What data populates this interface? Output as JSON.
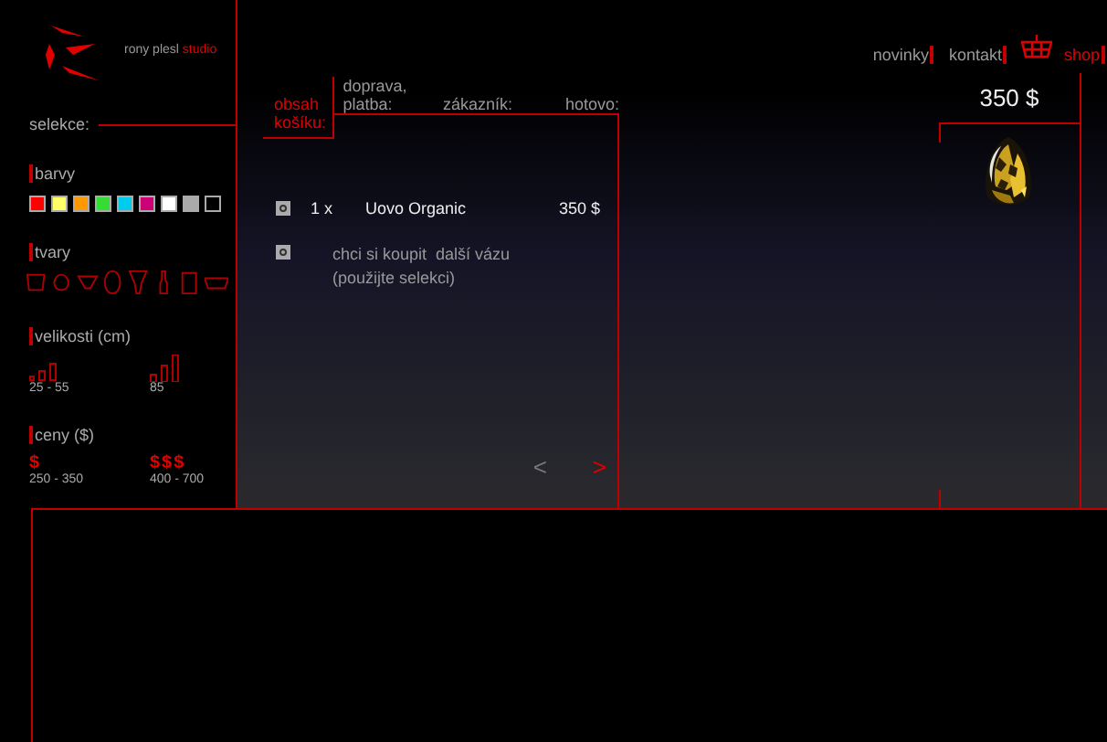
{
  "brand": {
    "name": "rony plesl",
    "suffix": "studio"
  },
  "nav": [
    {
      "label": "novinky",
      "selected": false,
      "kind": "text"
    },
    {
      "label": "kontakt",
      "selected": false,
      "kind": "text"
    },
    {
      "label": "shop",
      "selected": true,
      "kind": "basket"
    }
  ],
  "sidebar": {
    "title": "selekce:",
    "colors": {
      "heading": "barvy",
      "swatches": [
        {
          "color": "#ff0000"
        },
        {
          "color": "#ffff66"
        },
        {
          "color": "#ff9900"
        },
        {
          "color": "#33dd33"
        },
        {
          "color": "#00ccee"
        },
        {
          "color": "#cc0077"
        },
        {
          "color": "#ffffff"
        },
        {
          "color": "#aaaaaa"
        },
        {
          "color": "#000000"
        }
      ]
    },
    "shapes": {
      "heading": "tvary"
    },
    "sizes": {
      "heading": "velikosti (cm)",
      "groups": [
        {
          "label": "25 - 55"
        },
        {
          "label": "85"
        }
      ]
    },
    "prices": {
      "heading": "ceny ($)",
      "groups": [
        {
          "symbol": "$",
          "label": "250 - 350"
        },
        {
          "symbol": "$$$",
          "label": "400 - 700"
        }
      ]
    }
  },
  "steps": [
    {
      "label": "obsah košíku:",
      "selected": true
    },
    {
      "label": "doprava, platba:",
      "selected": false
    },
    {
      "label": "zákazník:",
      "selected": false
    },
    {
      "label": "hotovo:",
      "selected": false
    }
  ],
  "cart": [
    {
      "kind": "item",
      "quantity": "1 x",
      "name": "Uovo Organic",
      "price": "350 $"
    },
    {
      "kind": "hint",
      "lines": [
        "chci si koupit  další vázu",
        "(použijte selekci)"
      ]
    }
  ],
  "pager": {
    "prev": {
      "label": "<",
      "disabled": true
    },
    "next": {
      "label": ">",
      "disabled": false
    }
  },
  "product": {
    "price": "350 $"
  }
}
